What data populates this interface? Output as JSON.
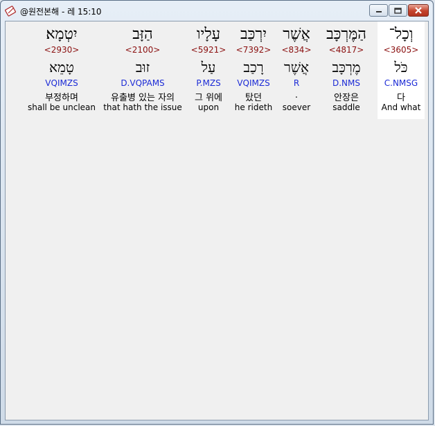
{
  "window": {
    "title": "@원전본해 - 레 15:10",
    "buttons": {
      "minimize": "minimize",
      "maximize": "maximize",
      "close": "close"
    }
  },
  "words": [
    {
      "hebrew": "וְכָל־",
      "strong": "<3605>",
      "lemma": "כֹּל",
      "parse": "C.NMSG",
      "korean": "다",
      "english": "And what"
    },
    {
      "hebrew": "הַמֶּרְכָּב",
      "strong": "<4817>",
      "lemma": "מֶרְכָּב",
      "parse": "D.NMS",
      "korean": "안장은",
      "english": "saddle"
    },
    {
      "hebrew": "אֲשֶׁר",
      "strong": "<834>",
      "lemma": "אֲשֶׁר",
      "parse": "R",
      "korean": ".",
      "english": "soever"
    },
    {
      "hebrew": "יִרְכַּב",
      "strong": "<7392>",
      "lemma": "רָכַב",
      "parse": "VQIMZS",
      "korean": "탔던",
      "english": "he rideth"
    },
    {
      "hebrew": "עָלָיו",
      "strong": "<5921>",
      "lemma": "עַל",
      "parse": "P.MZS",
      "korean": "그 위에",
      "english": "upon"
    },
    {
      "hebrew": "הַזָּב",
      "strong": "<2100>",
      "lemma": "זוּב",
      "parse": "D.VQPAMS",
      "korean": "유출병 있는 자의",
      "english": "that hath the issue"
    },
    {
      "hebrew": "יִטְמָא׃",
      "strong": "<2930>",
      "lemma": "טָמֵא",
      "parse": "VQIMZS",
      "korean": "부정하며",
      "english": "shall be unclean"
    }
  ]
}
